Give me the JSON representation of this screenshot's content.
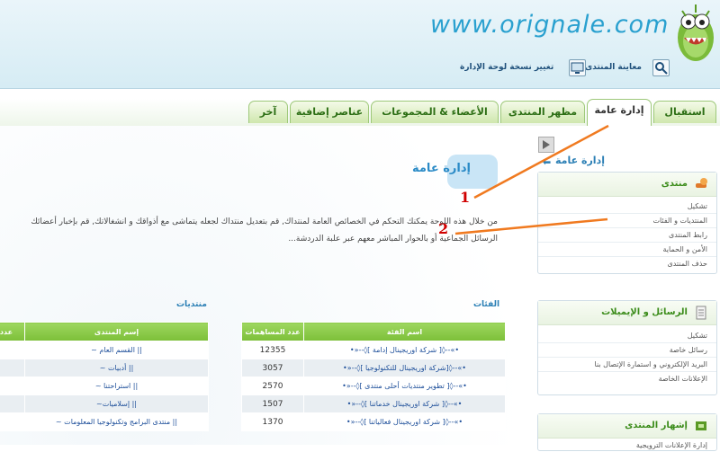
{
  "header": {
    "site_title": "www.orignale.com",
    "links": [
      {
        "label": "معاينة المنتدى"
      },
      {
        "label": "تغيير نسخة لوحة الإدارة"
      }
    ]
  },
  "tabs": [
    "استقبال",
    "إدارة عامة",
    "مظهر المنتدى",
    "الأعضاء & المجموعات",
    "عناصر إضافية",
    "آخر"
  ],
  "main": {
    "crumb": "إدارة عامة",
    "title": "إدارة عامة",
    "desc_line1": "من خلال هذه اللوحة يمكنك التحكم في الخصائص العامة لمنتداك, قم بتعديل منتداك لجعله يتماشى مع أذواقك و انشغالاتك, قم بإخبار أعضائك",
    "desc_line2": "الرسائل الجماعية أو بالحوار المباشر معهم عبر علبة الدردشة...",
    "categories_title": "الفئات",
    "forums_title": "منتديات",
    "categories_headers": {
      "count": "عدد المساهمات",
      "name": "اسم الفئة"
    },
    "forums_headers": {
      "name": "إسم المنتدى",
      "count": "عدد"
    },
    "categories_rows": [
      {
        "count": "12355",
        "name": "•»--◊[ شركة اوريجينال إدامة ]◊--«•"
      },
      {
        "count": "3057",
        "name": "•»--◊[شركة اوريجينال للتكنولوجيا ]◊--«•"
      },
      {
        "count": "2570",
        "name": "•»--◊[ تطوير منتديات أحلى منتدى ]◊--«•"
      },
      {
        "count": "1507",
        "name": "•»--◊[ شركة اوريجينال خدماتنا ]◊--«•"
      },
      {
        "count": "1370",
        "name": "•»--◊[ شركة اوريجينال فعالياتنا ]◊--«•"
      }
    ],
    "forums_rows": [
      {
        "name": "|| القسم العام ~"
      },
      {
        "name": "|| أدبيات ~"
      },
      {
        "name": "|| استراحتنا ~"
      },
      {
        "name": "|| إسلاميات~"
      },
      {
        "name": "|| منتدى البرامج وتكنولوجيا المعلومات ~"
      }
    ]
  },
  "sidebar": {
    "forum": {
      "title": "منتدى",
      "items": [
        "تشكيل",
        "المنتديات و الفئات",
        "رابط المنتدى",
        "الأمن و الحماية",
        "حذف المنتدى"
      ]
    },
    "messages": {
      "title": "الرسائل و الإيميلات",
      "items": [
        "تشكيل",
        "رسائل خاصة",
        "البريد الإلكتروني و استمارة الإتصال بنا",
        "الإعلانات الخاصة"
      ]
    },
    "promo": {
      "title": "إشهار المنتدى",
      "items": [
        "إدارة الإعلانات الترويجية"
      ]
    }
  },
  "annotations": {
    "label1": "1",
    "label2": "2",
    "color": "#f07a20"
  },
  "colors": {
    "accent_green": "#7cbf38",
    "link_blue": "#2b7fb5",
    "title_blue": "#29a0cf"
  }
}
